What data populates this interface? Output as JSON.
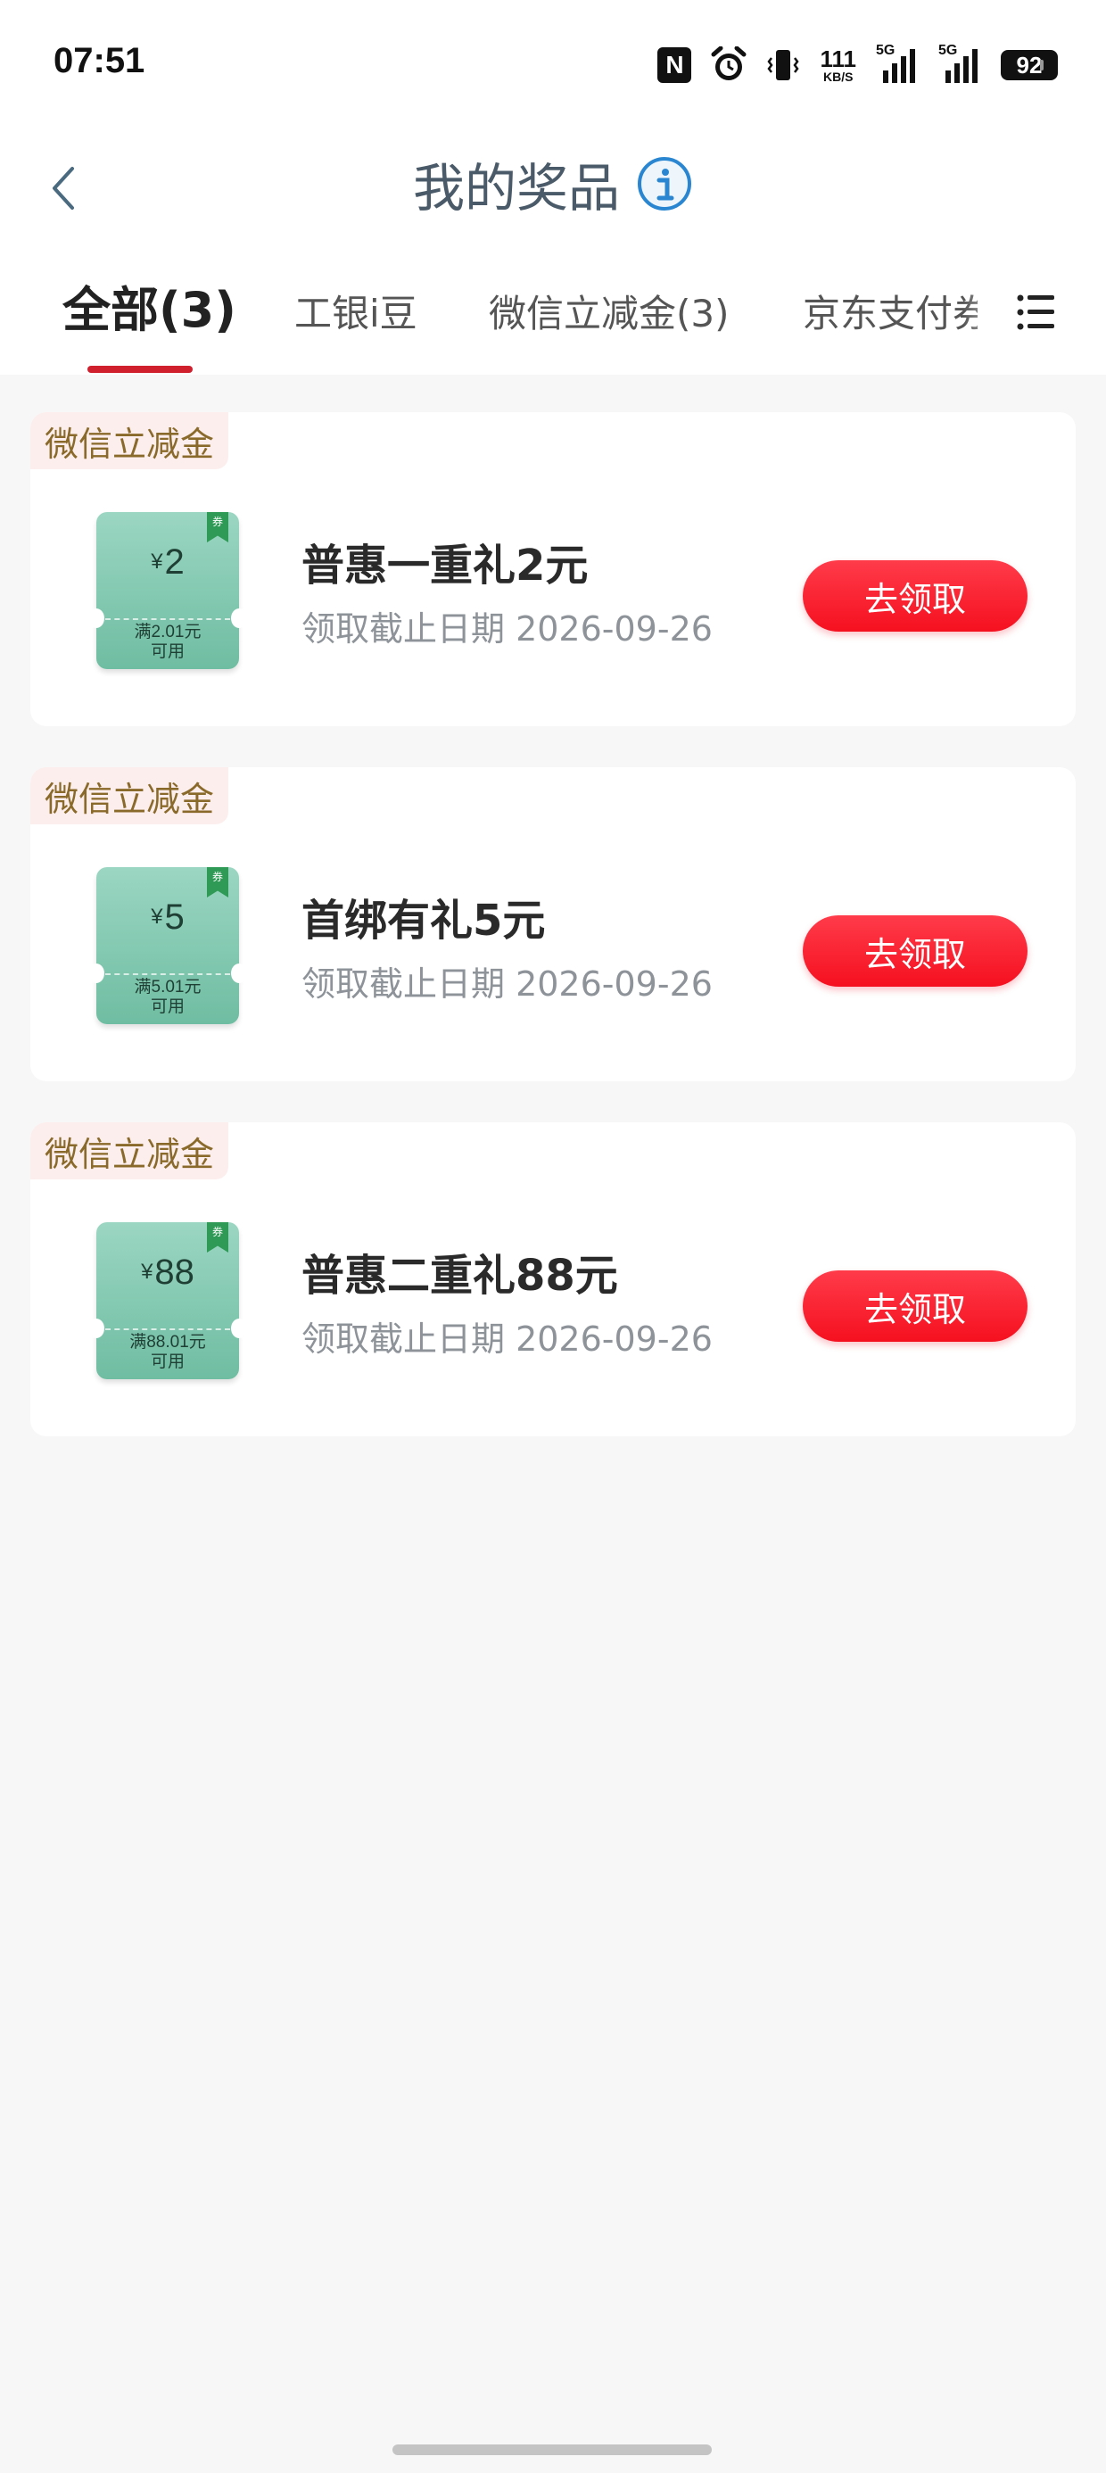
{
  "status_bar": {
    "time": "07:51",
    "nfc_label": "N",
    "speed_value": "111",
    "speed_unit": "KB/S",
    "sim1_label": "5G",
    "sim2_label": "5G",
    "battery": "92"
  },
  "header": {
    "title": "我的奖品",
    "back_icon": "chevron-left-icon",
    "info_icon": "info-icon",
    "accent_color": "#d0202e"
  },
  "tabs": [
    {
      "label": "全部(3)",
      "active": true
    },
    {
      "label": "工银i豆",
      "active": false
    },
    {
      "label": "微信立减金(3)",
      "active": false
    },
    {
      "label": "京东支付券",
      "active": false
    }
  ],
  "prizes": [
    {
      "tag": "微信立减金",
      "coupon_currency": "¥",
      "coupon_amount": "2",
      "coupon_condition_1": "满2.01元",
      "coupon_condition_2": "可用",
      "coupon_ribbon": "券",
      "name": "普惠一重礼2元",
      "deadline": "领取截止日期 2026-09-26",
      "button": "去领取"
    },
    {
      "tag": "微信立减金",
      "coupon_currency": "¥",
      "coupon_amount": "5",
      "coupon_condition_1": "满5.01元",
      "coupon_condition_2": "可用",
      "coupon_ribbon": "券",
      "name": "首绑有礼5元",
      "deadline": "领取截止日期 2026-09-26",
      "button": "去领取"
    },
    {
      "tag": "微信立减金",
      "coupon_currency": "¥",
      "coupon_amount": "88",
      "coupon_condition_1": "满88.01元",
      "coupon_condition_2": "可用",
      "coupon_ribbon": "券",
      "name": "普惠二重礼88元",
      "deadline": "领取截止日期 2026-09-26",
      "button": "去领取"
    }
  ]
}
